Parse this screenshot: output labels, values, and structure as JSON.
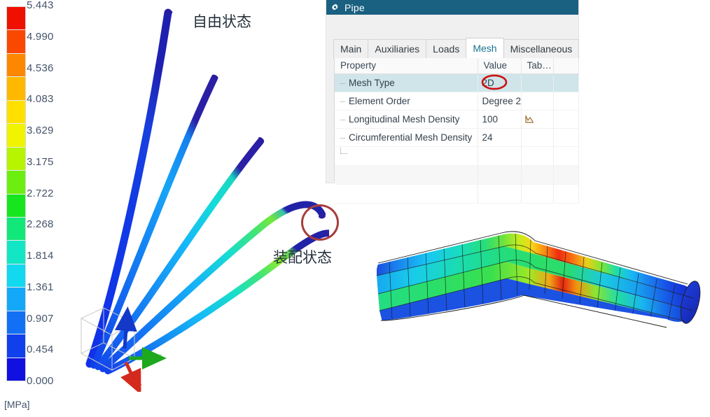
{
  "legend": {
    "name": "stress-color-legend",
    "unit": "[MPa]",
    "ticks": [
      "5.443",
      "4.990",
      "4.536",
      "4.083",
      "3.629",
      "3.175",
      "2.722",
      "2.268",
      "1.814",
      "1.361",
      "0.907",
      "0.454",
      "0.000"
    ],
    "band_colors": [
      "#f01000",
      "#fa4800",
      "#fd8800",
      "#ffb800",
      "#ffe000",
      "#f0f400",
      "#b6f400",
      "#6cee10",
      "#17e61e",
      "#12e77a",
      "#12e6c4",
      "#12d8f0",
      "#14a8f8",
      "#1270f4",
      "#1040ec",
      "#1010e0"
    ]
  },
  "viewport": {
    "name": "fem-3d-viewport",
    "labels": {
      "free_state": "自由状态",
      "assembled_state": "装配状态"
    },
    "axes": {
      "x": "X",
      "y": "Y",
      "z": "Z"
    },
    "axis_colors": {
      "x": "#d42a1e",
      "y": "#1ea81e",
      "z": "#1438c8"
    }
  },
  "dialog": {
    "name": "pipe-properties-dialog",
    "title": "Pipe",
    "titlebar_color": "#1a6080",
    "tabs": [
      {
        "label": "Main",
        "active": false
      },
      {
        "label": "Auxiliaries",
        "active": false
      },
      {
        "label": "Loads",
        "active": false
      },
      {
        "label": "Mesh",
        "active": true
      },
      {
        "label": "Miscellaneous",
        "active": false
      }
    ],
    "grid": {
      "columns": [
        "Property",
        "Value",
        "Tab…"
      ],
      "rows": [
        {
          "property": "Mesh Type",
          "value": "2D",
          "tab": "",
          "selected": true,
          "annotated": true
        },
        {
          "property": "Element Order",
          "value": "Degree 2",
          "tab": "",
          "selected": false,
          "annotated": false
        },
        {
          "property": "Longitudinal Mesh Density",
          "value": "100",
          "tab": "chart-icon",
          "selected": false,
          "annotated": false
        },
        {
          "property": "Circumferential Mesh Density",
          "value": "24",
          "tab": "",
          "selected": false,
          "annotated": false
        }
      ]
    },
    "annotation_color": "#cc1111"
  },
  "mesh_figure": {
    "name": "bent-pipe-mesh-detail",
    "description": "bent pipe finite element mesh with stress contour"
  }
}
